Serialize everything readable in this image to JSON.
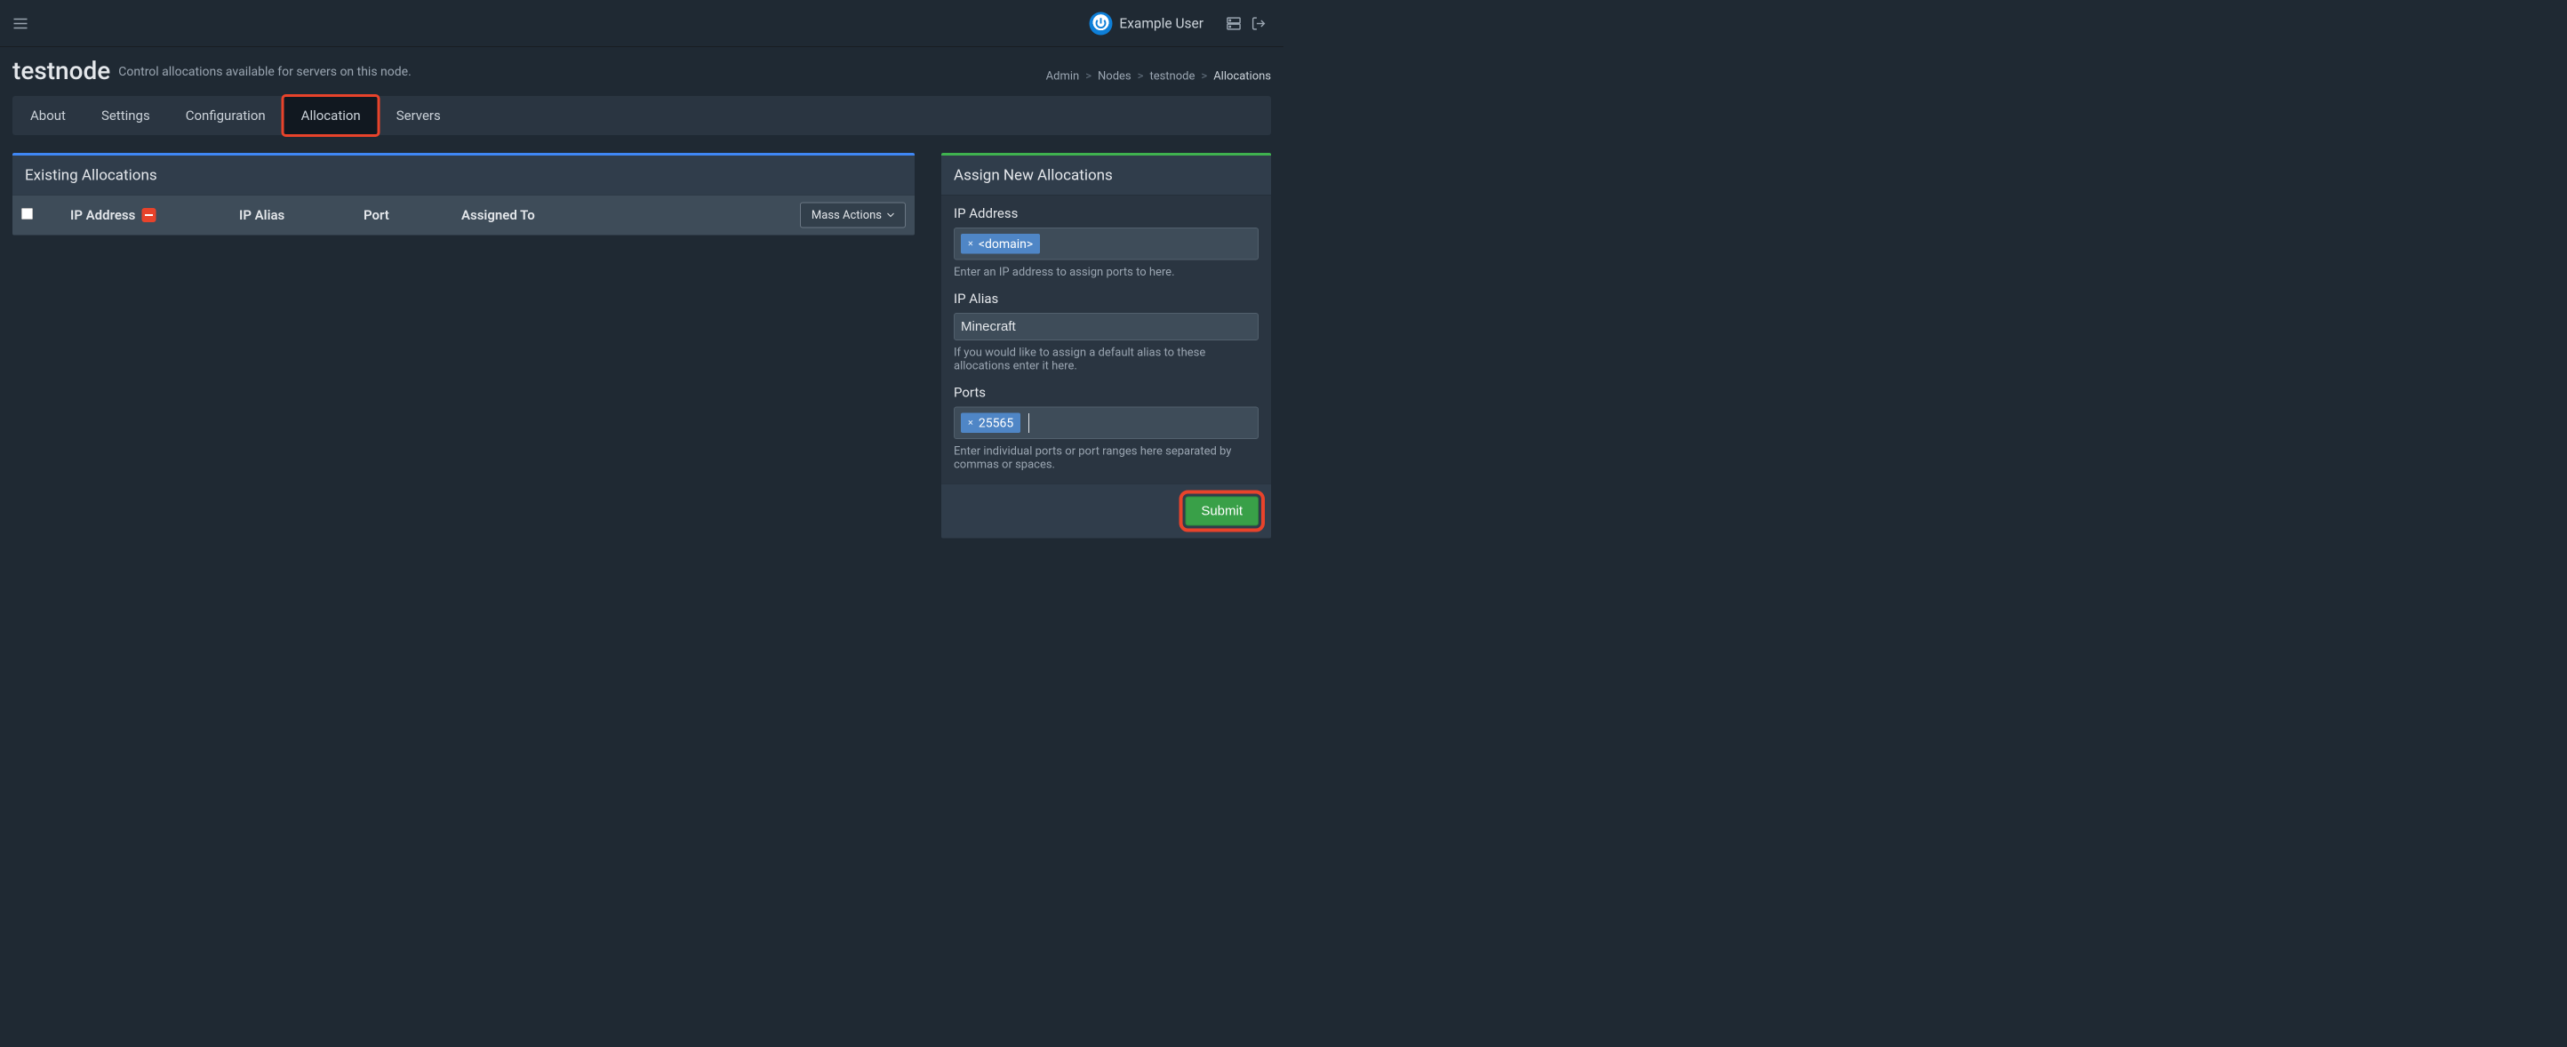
{
  "navbar": {
    "user_name": "Example User"
  },
  "header": {
    "title": "testnode",
    "subtitle": "Control allocations available for servers on this node."
  },
  "breadcrumb": {
    "items": [
      "Admin",
      "Nodes",
      "testnode",
      "Allocations"
    ]
  },
  "tabs": {
    "items": [
      "About",
      "Settings",
      "Configuration",
      "Allocation",
      "Servers"
    ],
    "active_index": 3
  },
  "existing": {
    "title": "Existing Allocations",
    "columns": {
      "ip": "IP Address",
      "alias": "IP Alias",
      "port": "Port",
      "assigned": "Assigned To"
    },
    "mass_actions_label": "Mass Actions"
  },
  "assign": {
    "title": "Assign New Allocations",
    "ip": {
      "label": "IP Address",
      "tag": "<domain>",
      "help": "Enter an IP address to assign ports to here."
    },
    "alias": {
      "label": "IP Alias",
      "value": "Minecraft",
      "help": "If you would like to assign a default alias to these allocations enter it here."
    },
    "ports": {
      "label": "Ports",
      "tag": "25565",
      "help": "Enter individual ports or port ranges here separated by commas or spaces."
    },
    "submit_label": "Submit"
  }
}
